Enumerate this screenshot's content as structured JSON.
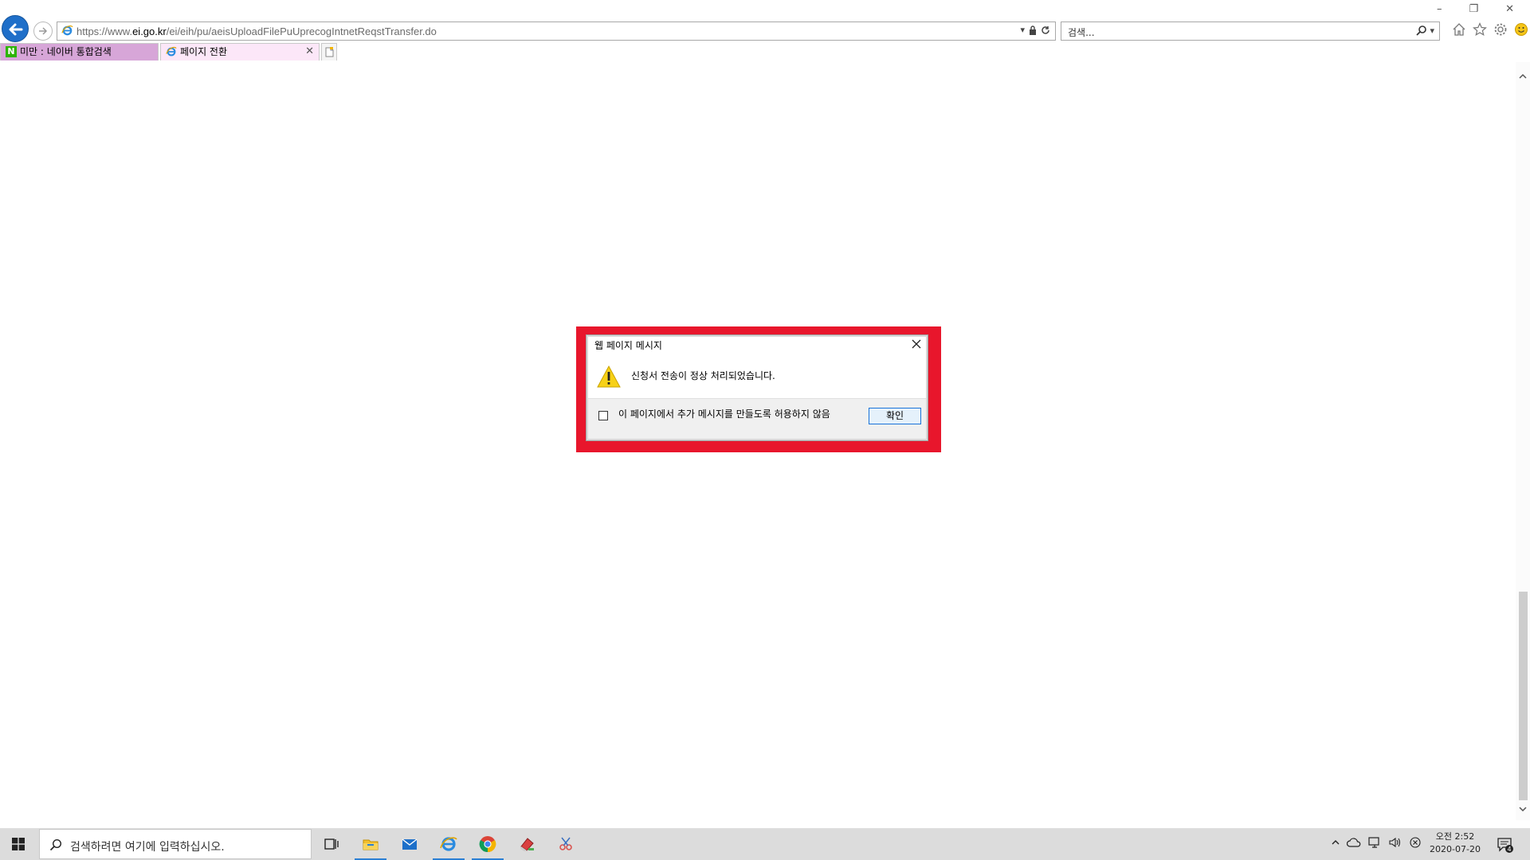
{
  "browser": {
    "url_prefix": "https://www.",
    "url_host": "ei.go.kr",
    "url_path": "/ei/eih/pu/aeisUploadFilePuUprecogIntnetReqstTransfer.do",
    "search_placeholder": "검색...",
    "tabs": [
      {
        "label": "미만 : 네이버 통합검색",
        "badge": "N"
      },
      {
        "label": "페이지 전환"
      }
    ],
    "close_glyph": "✕",
    "window_controls": [
      "–",
      "❐",
      "✕"
    ]
  },
  "dialog": {
    "title": "웹 페이지 메시지",
    "message": "신청서 전송이 정상 처리되었습니다.",
    "checkbox_label": "이 페이지에서 추가 메시지를 만들도록 허용하지 않음",
    "ok_label": "확인",
    "highlight_color": "#e8162c"
  },
  "taskbar": {
    "search_placeholder": "검색하려면 여기에 입력하십시오.",
    "clock_time": "오전 2:52",
    "clock_date": "2020-07-20",
    "notification_count": "4"
  }
}
